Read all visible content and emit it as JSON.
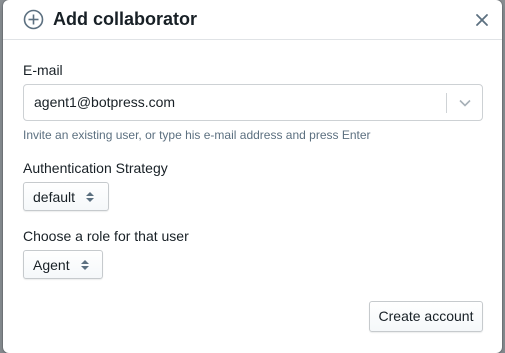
{
  "dialog": {
    "title": "Add collaborator",
    "header_icon": "plus-circle-icon",
    "close_icon": "close-icon"
  },
  "email": {
    "label": "E-mail",
    "value": "agent1@botpress.com",
    "dropdown_icon": "chevron-down-icon",
    "helper": "Invite an existing user, or type his e-mail address and press Enter"
  },
  "auth_strategy": {
    "label": "Authentication Strategy",
    "selected": "default",
    "icon": "sort-icon"
  },
  "role": {
    "label": "Choose a role for that user",
    "selected": "Agent",
    "icon": "sort-icon"
  },
  "actions": {
    "create_label": "Create account"
  },
  "colors": {
    "text": "#182026",
    "muted_text": "#5c7080",
    "border": "#cdd1d4",
    "backdrop": "#8a8f93"
  }
}
